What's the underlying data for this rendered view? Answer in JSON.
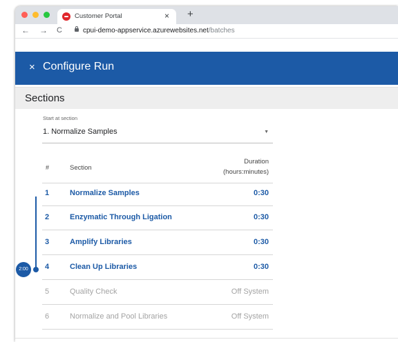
{
  "browser": {
    "tab_title": "Customer Portal",
    "tab_close": "×",
    "new_tab": "+",
    "back": "←",
    "forward": "→",
    "reload": "C",
    "url_host": "cpui-demo-appservice.azurewebsites.net",
    "url_path": "/batches",
    "traffic_lights": [
      "#ff5f57",
      "#febc2e",
      "#28c840"
    ],
    "favicon_color": "#e0262b"
  },
  "header": {
    "close_icon": "×",
    "title": "Configure Run",
    "background": "#1c5aa6"
  },
  "sections": {
    "title": "Sections",
    "start_label": "Start at section",
    "start_value": "1. Normalize Samples",
    "table": {
      "col_num": "#",
      "col_section": "Section",
      "col_duration_line1": "Duration",
      "col_duration_line2": "(hours:minutes)",
      "rows": [
        {
          "num": "1",
          "name": "Normalize Samples",
          "duration": "0:30",
          "active": true
        },
        {
          "num": "2",
          "name": "Enzymatic Through Ligation",
          "duration": "0:30",
          "active": true
        },
        {
          "num": "3",
          "name": "Amplify Libraries",
          "duration": "0:30",
          "active": true
        },
        {
          "num": "4",
          "name": "Clean Up Libraries",
          "duration": "0:30",
          "active": true
        },
        {
          "num": "5",
          "name": "Quality Check",
          "duration": "Off System",
          "active": false
        },
        {
          "num": "6",
          "name": "Normalize and Pool Libraries",
          "duration": "Off System",
          "active": false
        }
      ]
    },
    "timeline_total": "2:00"
  },
  "colors": {
    "accent": "#1c5aa6",
    "inactive_text": "#a3a3a3"
  }
}
